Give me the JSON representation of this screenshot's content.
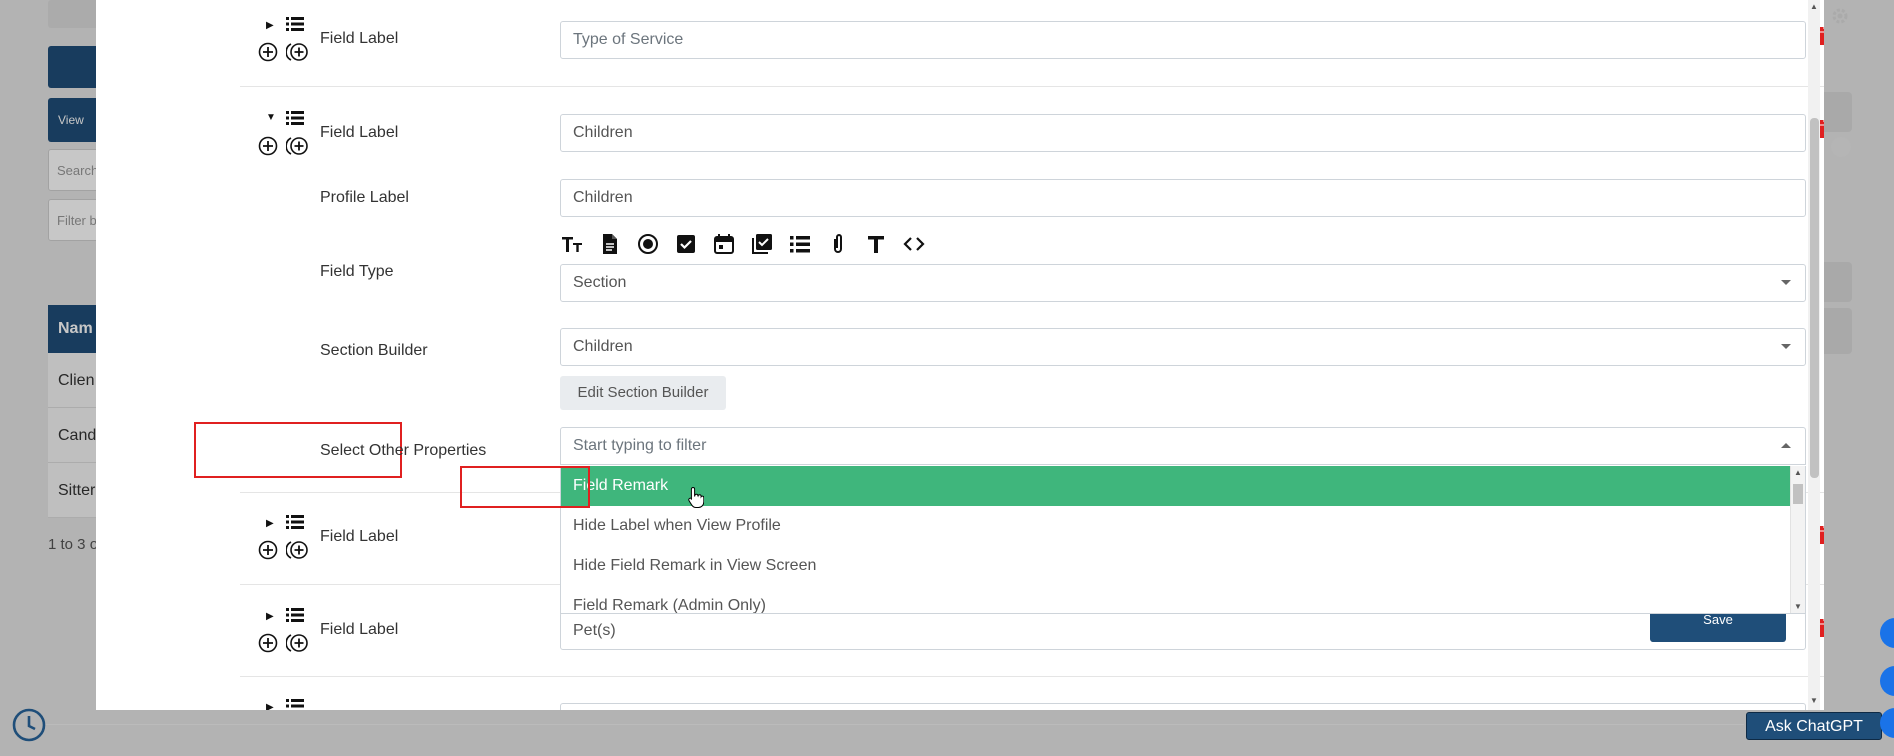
{
  "background": {
    "view_button": "View",
    "search_placeholder": "Search",
    "filter_placeholder": "Filter b",
    "table_header": "Nam",
    "rows": [
      "Clien",
      "Cand",
      "Sitter"
    ],
    "count_text": "1 to 3 o"
  },
  "modal": {
    "fields": [
      {
        "label": "Field Label",
        "value": "Type of Service",
        "placeholder": true
      },
      {
        "label": "Field Label",
        "value": "Children",
        "placeholder": false
      }
    ],
    "profile_label": {
      "label": "Profile Label",
      "value": "Children"
    },
    "field_type": {
      "label": "Field Type",
      "value": "Section"
    },
    "section_builder": {
      "label": "Section Builder",
      "value": "Children"
    },
    "edit_section_builder": "Edit Section Builder",
    "other_properties": {
      "label": "Select Other Properties",
      "placeholder": "Start typing to filter"
    },
    "dropdown_options": [
      "Field Remark",
      "Hide Label when View Profile",
      "Hide Field Remark in View Screen",
      "Field Remark (Admin Only)"
    ],
    "lower_fields": [
      {
        "label": "Field Label",
        "value": ""
      },
      {
        "label": "Field Label",
        "value": "Pet(s)"
      }
    ],
    "save_label": "Save",
    "toolbar_icons": [
      "text-size-icon",
      "document-icon",
      "radio-icon",
      "checkbox-icon",
      "calendar-icon",
      "checklist-icon",
      "list-icon",
      "paperclip-icon",
      "text-icon",
      "code-icon"
    ]
  },
  "footer": {
    "ask_label": "Ask ChatGPT"
  },
  "colors": {
    "primary": "#1f4e79",
    "highlight": "#3fb67c",
    "danger": "#e02020"
  }
}
